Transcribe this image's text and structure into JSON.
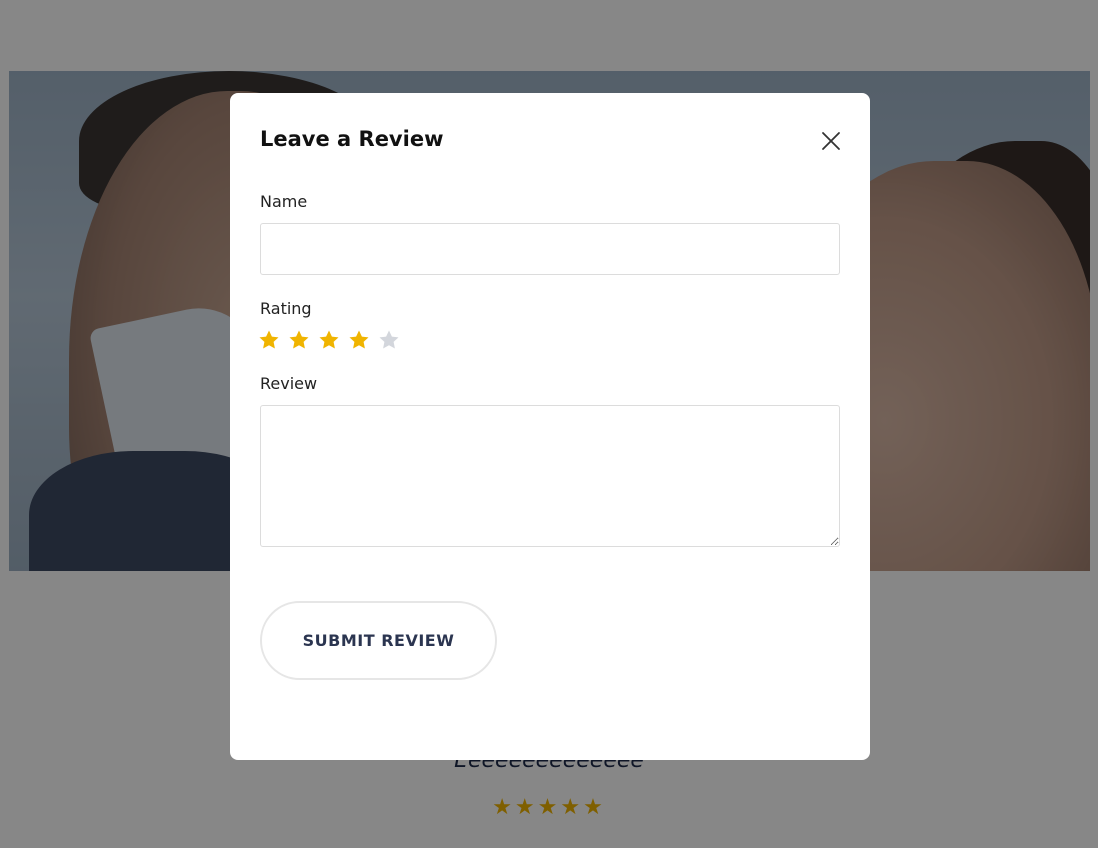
{
  "background": {
    "review_title": "Eeeeeeeeeeeeee",
    "review_stars": "★★★★★",
    "star_color": "#f0b400"
  },
  "modal": {
    "title": "Leave a Review",
    "close_icon": "close-icon",
    "name": {
      "label": "Name",
      "value": "",
      "placeholder": ""
    },
    "rating": {
      "label": "Rating",
      "value": 4,
      "max": 5,
      "filled_color": "#f0b400",
      "empty_color": "#d3d6dc",
      "icon": "star-icon"
    },
    "review": {
      "label": "Review",
      "value": "",
      "placeholder": ""
    },
    "submit_label": "SUBMIT REVIEW"
  }
}
